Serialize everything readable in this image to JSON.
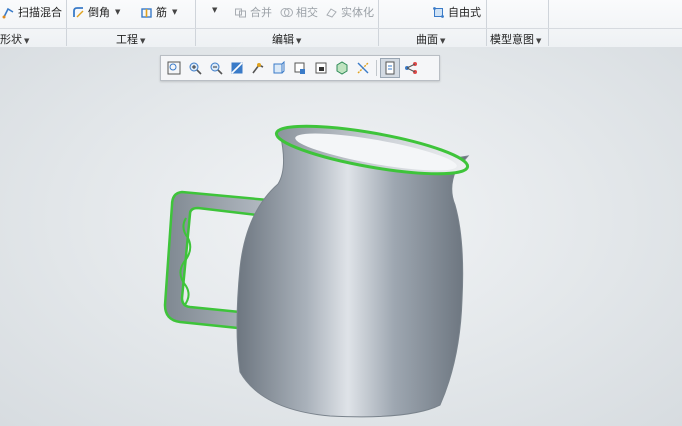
{
  "ribbon": {
    "sweep_blend": "扫描混合",
    "round": "倒角",
    "rib": "筋",
    "merge": "合并",
    "intersect": "相交",
    "solidify": "实体化",
    "freestyle": "自由式"
  },
  "groups": {
    "shapes": "形状",
    "engineering": "工程",
    "editing": "编辑",
    "surfaces": "曲面",
    "model_intent": "模型意图"
  },
  "view_toolbar": {
    "icons": [
      "zoom-fit-icon",
      "zoom-in-icon",
      "zoom-out-icon",
      "repaint-icon",
      "reorient-icon",
      "saved-views-icon",
      "display-style-icon",
      "perspective-icon",
      "section-icon",
      "datum-display-icon",
      "spin-center-icon",
      "annotation-icon",
      "sketch-view-icon"
    ]
  },
  "colors": {
    "model_body": "#9aa3ad",
    "edge_highlight": "#3ec43a",
    "viewport_bg": "#e3e7ea"
  }
}
